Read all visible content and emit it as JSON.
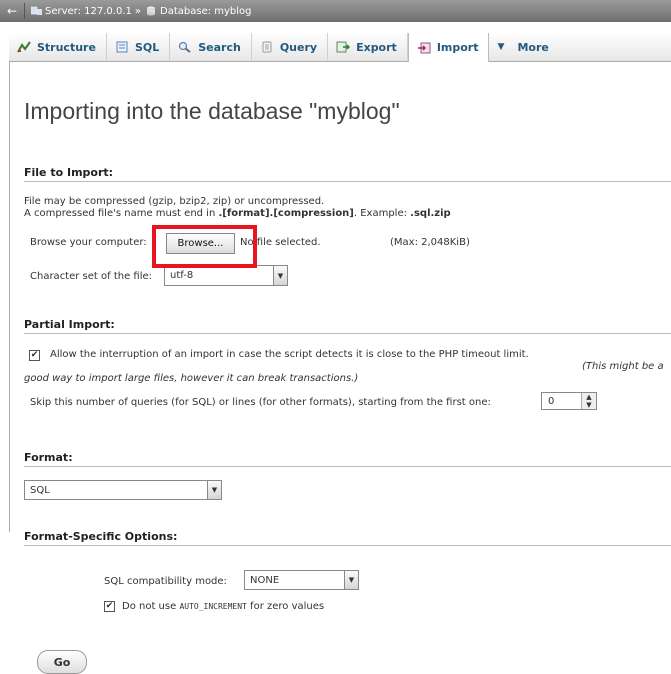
{
  "breadcrumb": {
    "server": "Server: 127.0.0.1",
    "separator": "»",
    "database": "Database: myblog"
  },
  "tabs": [
    {
      "label": "Structure",
      "icon": "structure-icon"
    },
    {
      "label": "SQL",
      "icon": "sql-icon"
    },
    {
      "label": "Search",
      "icon": "search-icon"
    },
    {
      "label": "Query",
      "icon": "query-icon"
    },
    {
      "label": "Export",
      "icon": "export-icon"
    },
    {
      "label": "Import",
      "icon": "import-icon",
      "active": true
    },
    {
      "label": "More",
      "icon": "chevron-down-icon"
    }
  ],
  "page_title": "Importing into the database \"myblog\"",
  "file_to_import": {
    "title": "File to Import:",
    "line1": "File may be compressed (gzip, bzip2, zip) or uncompressed.",
    "line2_pre": "A compressed file's name must end in ",
    "line2_bold": ".[format].[compression]",
    "line2_mid": ". Example: ",
    "line2_example": ".sql.zip",
    "browse_label": "Browse your computer:",
    "browse_button": "Browse...",
    "no_file": "No file selected.",
    "max": "(Max: 2,048KiB)",
    "charset_label": "Character set of the file:",
    "charset_value": "utf-8"
  },
  "partial_import": {
    "title": "Partial Import:",
    "allow_text": "Allow the interruption of an import in case the script detects it is close to the PHP timeout limit.",
    "allow_note": "(This might be a good way to import large files, however it can break transactions.)",
    "allow_checked": true,
    "skip_label": "Skip this number of queries (for SQL) or lines (for other formats), starting from the first one:",
    "skip_value": "0"
  },
  "format": {
    "title": "Format:",
    "value": "SQL"
  },
  "format_options": {
    "title": "Format-Specific Options:",
    "compat_label": "SQL compatibility mode:",
    "compat_value": "NONE",
    "auto_inc_pre": "Do not use ",
    "auto_inc_code": "AUTO_INCREMENT",
    "auto_inc_post": " for zero values",
    "auto_inc_checked": true
  },
  "go_button": "Go",
  "colors": {
    "highlight": "#e8141e",
    "link": "#235a81"
  }
}
